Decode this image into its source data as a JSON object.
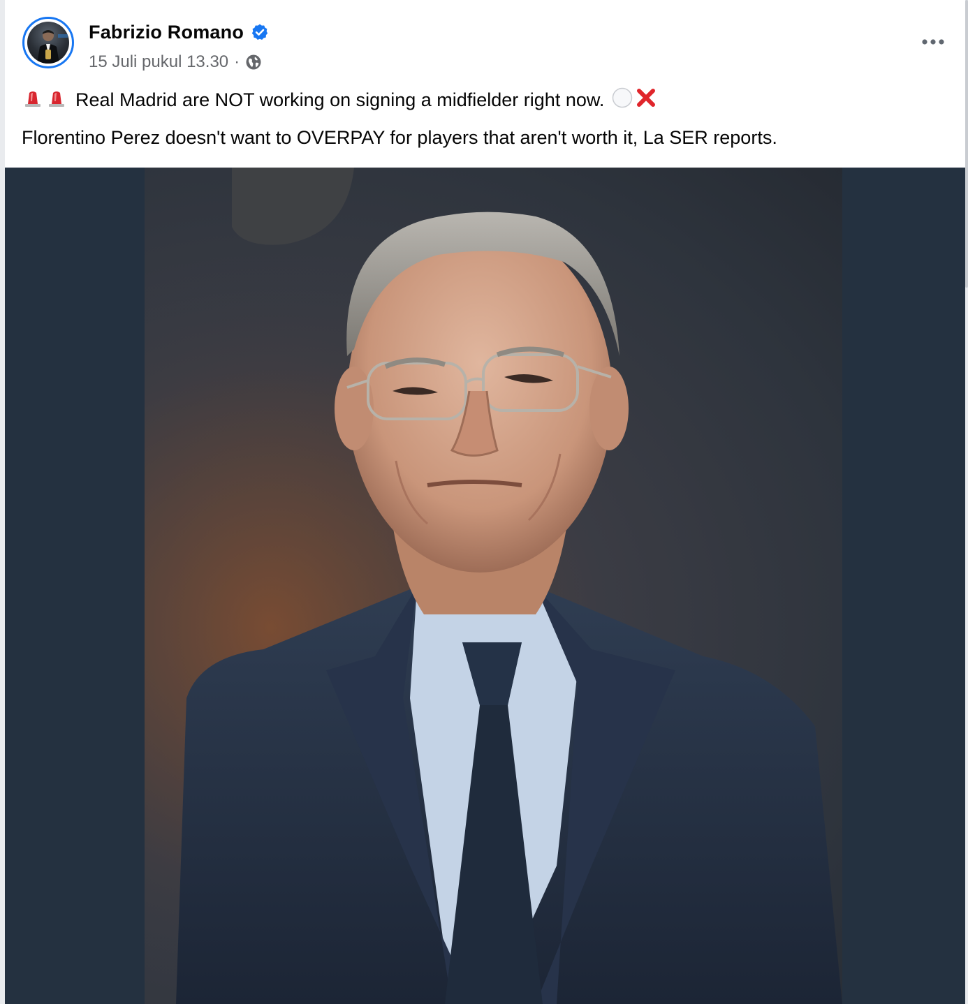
{
  "post": {
    "author": {
      "name": "Fabrizio Romano",
      "verified": true,
      "avatar_icon": "profile-photo"
    },
    "meta": {
      "timestamp": "15 Juli pukul 13.30",
      "separator": "·",
      "audience_icon": "globe-icon"
    },
    "more_icon": "more-options-icon",
    "text": {
      "line1_text": "Real Madrid are NOT working on signing a midfielder right now.",
      "line1_leading_emojis": [
        "siren-icon",
        "siren-icon"
      ],
      "line1_trailing_emojis": [
        "white-circle-icon",
        "cross-mark-icon"
      ],
      "line2": "Florentino Perez doesn't want to OVERPAY for players that aren't worth it, La SER reports."
    },
    "media": {
      "type": "photo"
    }
  },
  "colors": {
    "accent": "#1877f2",
    "verified_badge": "#1877f2",
    "primary_text": "#050505",
    "secondary_text": "#65676b",
    "media_backdrop": "#243140",
    "cross_mark": "#e0252b",
    "siren": "#d8262f"
  }
}
